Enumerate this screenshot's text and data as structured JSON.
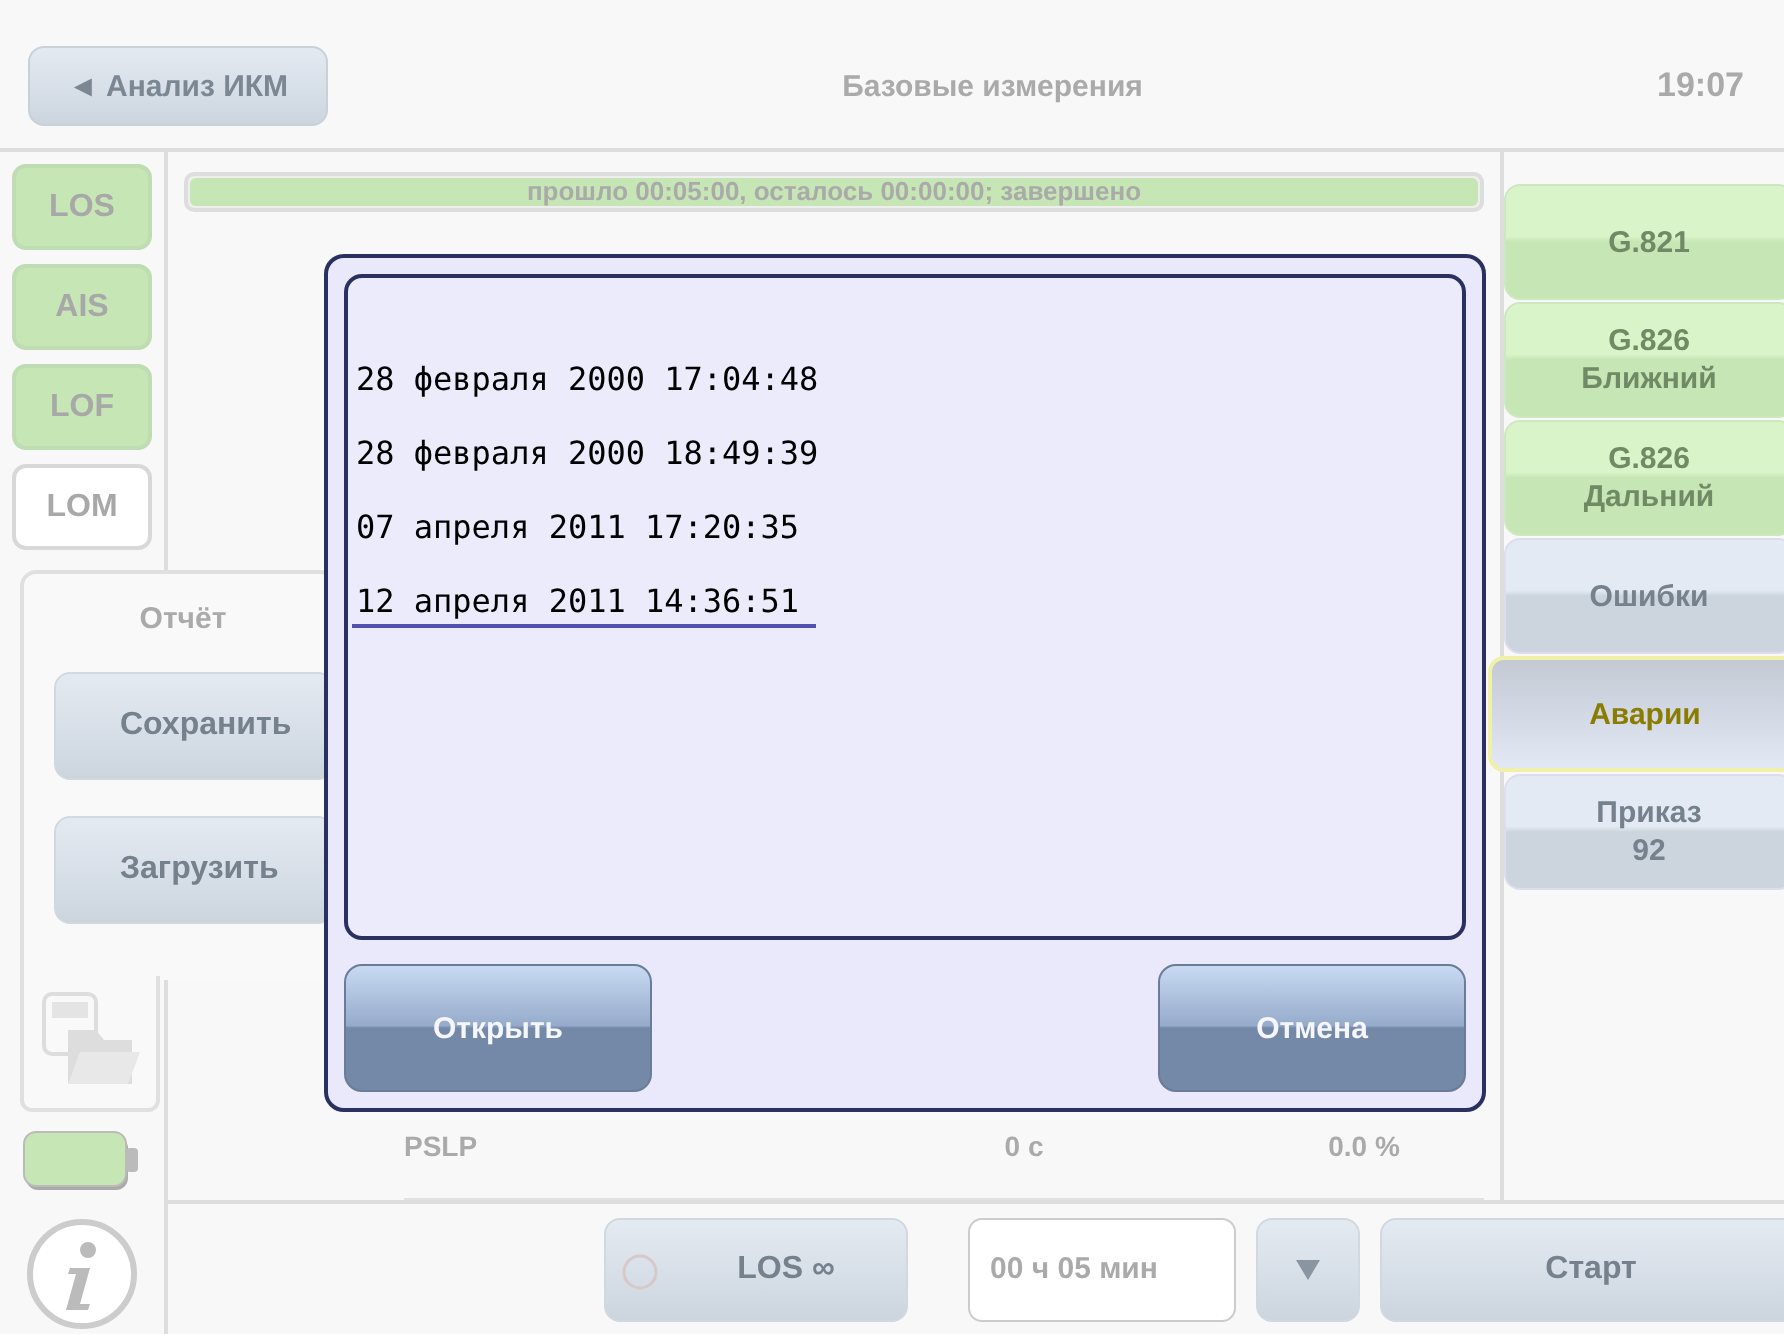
{
  "header": {
    "back_button": "◄ Анализ ИКМ",
    "title": "Базовые измерения",
    "time": "19:07"
  },
  "alarms": [
    {
      "label": "LOS",
      "active": true
    },
    {
      "label": "AIS",
      "active": true
    },
    {
      "label": "LOF",
      "active": true
    },
    {
      "label": "LOM",
      "active": false
    }
  ],
  "progress": {
    "text": "прошло 00:05:00, осталось 00:00:00; завершено",
    "level": 1
  },
  "results": [
    {
      "name": "PSLP",
      "time": "0 с",
      "percent": "0.0 %"
    }
  ],
  "tabs": [
    {
      "lines": [
        "G.821"
      ],
      "passed": true,
      "selected": false
    },
    {
      "lines": [
        "G.826",
        "Ближний"
      ],
      "passed": true,
      "selected": false
    },
    {
      "lines": [
        "G.826",
        "Дальний"
      ],
      "passed": true,
      "selected": false
    },
    {
      "lines": [
        "Ошибки"
      ],
      "passed": false,
      "selected": false
    },
    {
      "lines": [
        "Аварии"
      ],
      "passed": false,
      "selected": true
    },
    {
      "lines": [
        "Приказ",
        "92"
      ],
      "passed": false,
      "selected": false
    }
  ],
  "report_panel": {
    "title": "Отчёт",
    "buttons": [
      "Сохранить",
      "Загрузить"
    ]
  },
  "bottom_bar": {
    "trigger_button": "LOS ∞",
    "duration": "00 ч 05 мин",
    "start_button": "Старт"
  },
  "dialog": {
    "files": [
      {
        "name": "28 февраля 2000 17:04:48",
        "selected": false
      },
      {
        "name": "28 февраля 2000 18:49:39",
        "selected": false
      },
      {
        "name": "07 апреля 2011 17:20:35",
        "selected": false
      },
      {
        "name": "12 апреля 2011 14:36:51",
        "selected": true
      }
    ],
    "buttons": [
      "Открыть",
      "Отмена"
    ]
  }
}
